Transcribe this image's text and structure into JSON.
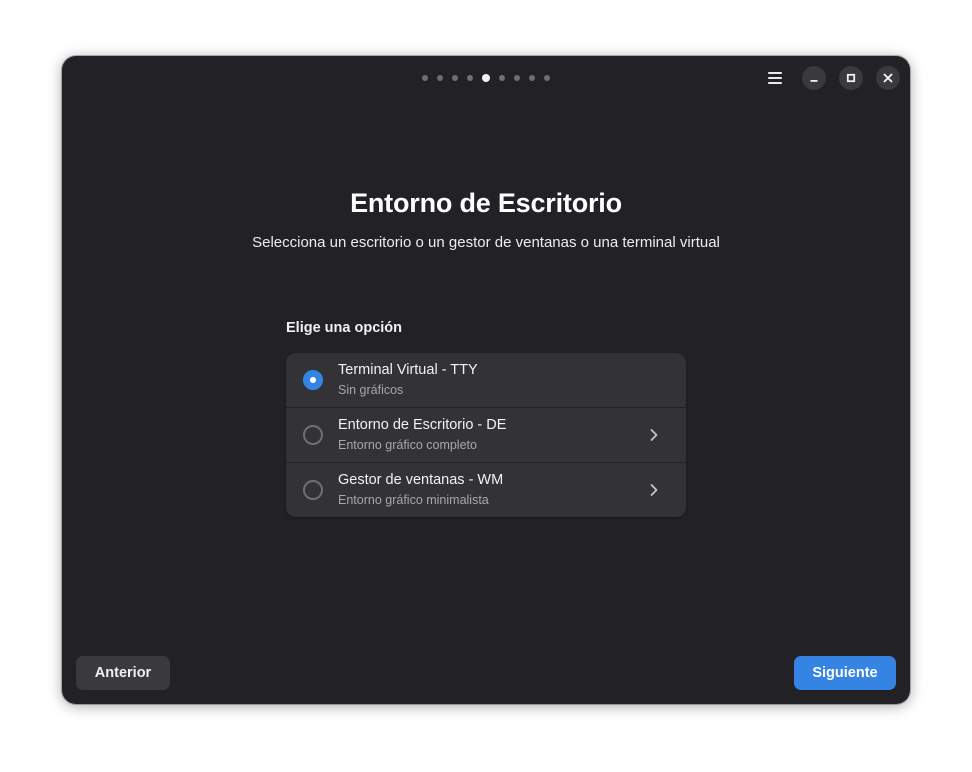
{
  "pager": {
    "count": 9,
    "active_index": 4
  },
  "heading": {
    "title": "Entorno de Escritorio",
    "subtitle": "Selecciona un escritorio o un gestor de ventanas o una terminal virtual"
  },
  "options": {
    "label": "Elige una opción",
    "items": [
      {
        "title": "Terminal Virtual - TTY",
        "subtitle": "Sin gráficos",
        "selected": true,
        "has_chevron": false
      },
      {
        "title": "Entorno de Escritorio - DE",
        "subtitle": "Entorno gráfico completo",
        "selected": false,
        "has_chevron": true
      },
      {
        "title": "Gestor de ventanas - WM",
        "subtitle": "Entorno gráfico minimalista",
        "selected": false,
        "has_chevron": true
      }
    ]
  },
  "footer": {
    "prev_label": "Anterior",
    "next_label": "Siguiente"
  },
  "icons": {
    "menu": "hamburger-menu-icon",
    "minimize": "minimize-icon",
    "maximize": "maximize-icon",
    "close": "close-icon",
    "chevron": "chevron-right-icon"
  },
  "colors": {
    "window_bg": "#222226",
    "card_bg": "#333337",
    "accent": "#3584e4",
    "text_primary": "#ffffff",
    "text_secondary": "#a6a6ab"
  }
}
